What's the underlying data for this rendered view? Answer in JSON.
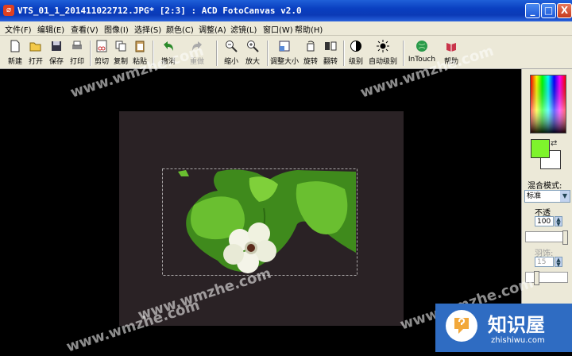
{
  "window": {
    "title": "VTS_01_1_201411022712.JPG* [2:3] : ACD FotoCanvas v2.0",
    "minimize_label": "_",
    "maximize_label": "□",
    "close_label": "X"
  },
  "menu": [
    "文件(F)",
    "编辑(E)",
    "查看(V)",
    "图像(I)",
    "选择(S)",
    "颜色(C)",
    "调整(A)",
    "滤镜(L)",
    "窗口(W)",
    "帮助(H)"
  ],
  "toolbar": {
    "new": "新建",
    "open": "打开",
    "save": "保存",
    "print": "打印",
    "cut": "剪切",
    "copy": "复制",
    "paste": "粘贴",
    "undo": "撤消",
    "redo": "重做",
    "zoom_out": "缩小",
    "zoom_in": "放大",
    "resize": "调整大小",
    "rotate": "旋转",
    "flip": "翻转",
    "levels": "级别",
    "auto_levels": "自动级别",
    "intouch": "InTouch",
    "help": "帮助"
  },
  "panel": {
    "blend_mode_label": "混合模式:",
    "blend_mode_value": "标准",
    "opacity_label": "不透",
    "opacity_value": "100",
    "feather_label": "羽饰:",
    "feather_value": "15"
  },
  "colors": {
    "foreground": "#7ef42c",
    "background": "#ffffff"
  },
  "watermarks": [
    "www.wmzhe.com"
  ],
  "logo": {
    "name": "知识屋",
    "url": "zhishiwu.com"
  }
}
